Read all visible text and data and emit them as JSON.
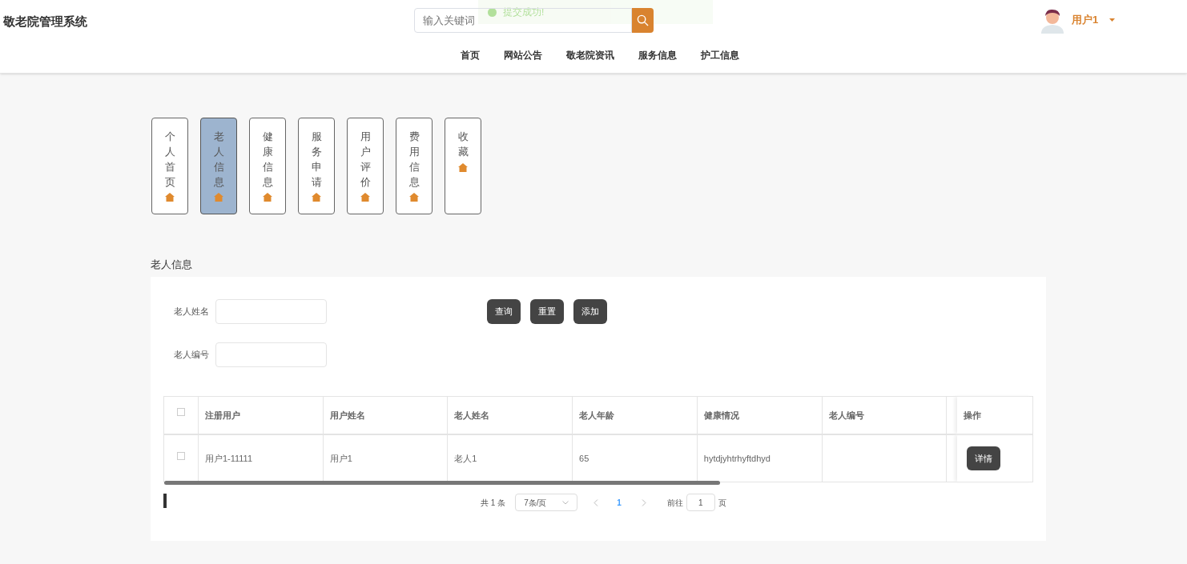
{
  "header": {
    "title": "敬老院管理系统",
    "search": {
      "placeholder": "输入关键词"
    },
    "toast": "提交成功!",
    "user": "用户1",
    "nav": [
      "首页",
      "网站公告",
      "敬老院资讯",
      "服务信息",
      "护工信息"
    ]
  },
  "side_tabs": [
    {
      "label": "个人首页",
      "selected": false
    },
    {
      "label": "老人信息",
      "selected": true
    },
    {
      "label": "健康信息",
      "selected": false
    },
    {
      "label": "服务申请",
      "selected": false
    },
    {
      "label": "用户评价",
      "selected": false
    },
    {
      "label": "费用信息",
      "selected": false
    },
    {
      "label": "收藏",
      "selected": false
    }
  ],
  "section_title": "老人信息",
  "filters": [
    {
      "label": "老人姓名"
    },
    {
      "label": "老人编号"
    }
  ],
  "buttons": [
    "查询",
    "重置",
    "添加"
  ],
  "table": {
    "all_checked": false,
    "columns": [
      "注册用户",
      "用户姓名",
      "老人姓名",
      "老人年龄",
      "健康情况",
      "老人编号"
    ],
    "action_column": "操作",
    "rows": [
      {
        "checked": false,
        "cells": [
          "用户1-11111",
          "用户1",
          "老人1",
          "65",
          "hytdjyhtrhyftdhyd",
          ""
        ],
        "action": "详情"
      }
    ]
  },
  "pagination": {
    "total": "共 1 条",
    "page_size": "7条/页",
    "current": "1",
    "goto_label": "前往",
    "goto_value": "1",
    "page_unit": "页"
  }
}
